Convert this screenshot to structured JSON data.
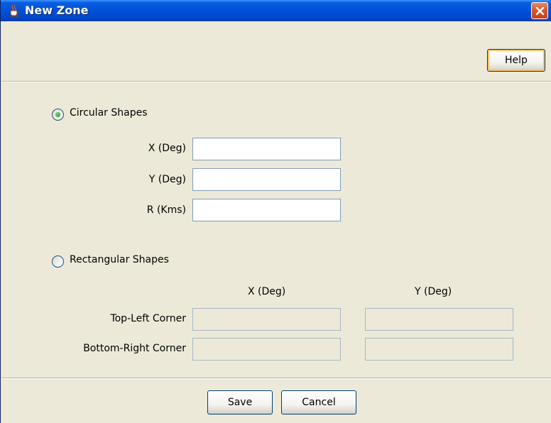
{
  "window": {
    "title": "New Zone",
    "colors": {
      "titlebar": "#0050d8",
      "close": "#c8401c",
      "body": "#ece9d8"
    }
  },
  "toolbar": {
    "help_label": "Help"
  },
  "circular": {
    "label": "Circular Shapes",
    "selected": true,
    "fields": [
      {
        "label": "X (Deg)",
        "value": ""
      },
      {
        "label": "Y (Deg)",
        "value": ""
      },
      {
        "label": "R (Kms)",
        "value": ""
      }
    ]
  },
  "rectangular": {
    "label": "Rectangular Shapes",
    "selected": false,
    "col_x": "X (Deg)",
    "col_y": "Y (Deg)",
    "rows": [
      {
        "label": "Top-Left Corner",
        "x_value": "",
        "y_value": ""
      },
      {
        "label": "Bottom-Right Corner",
        "x_value": "",
        "y_value": ""
      }
    ]
  },
  "footer": {
    "save_label": "Save",
    "cancel_label": "Cancel"
  },
  "icons": {
    "app": "java-coffee-icon",
    "close": "close-icon"
  }
}
